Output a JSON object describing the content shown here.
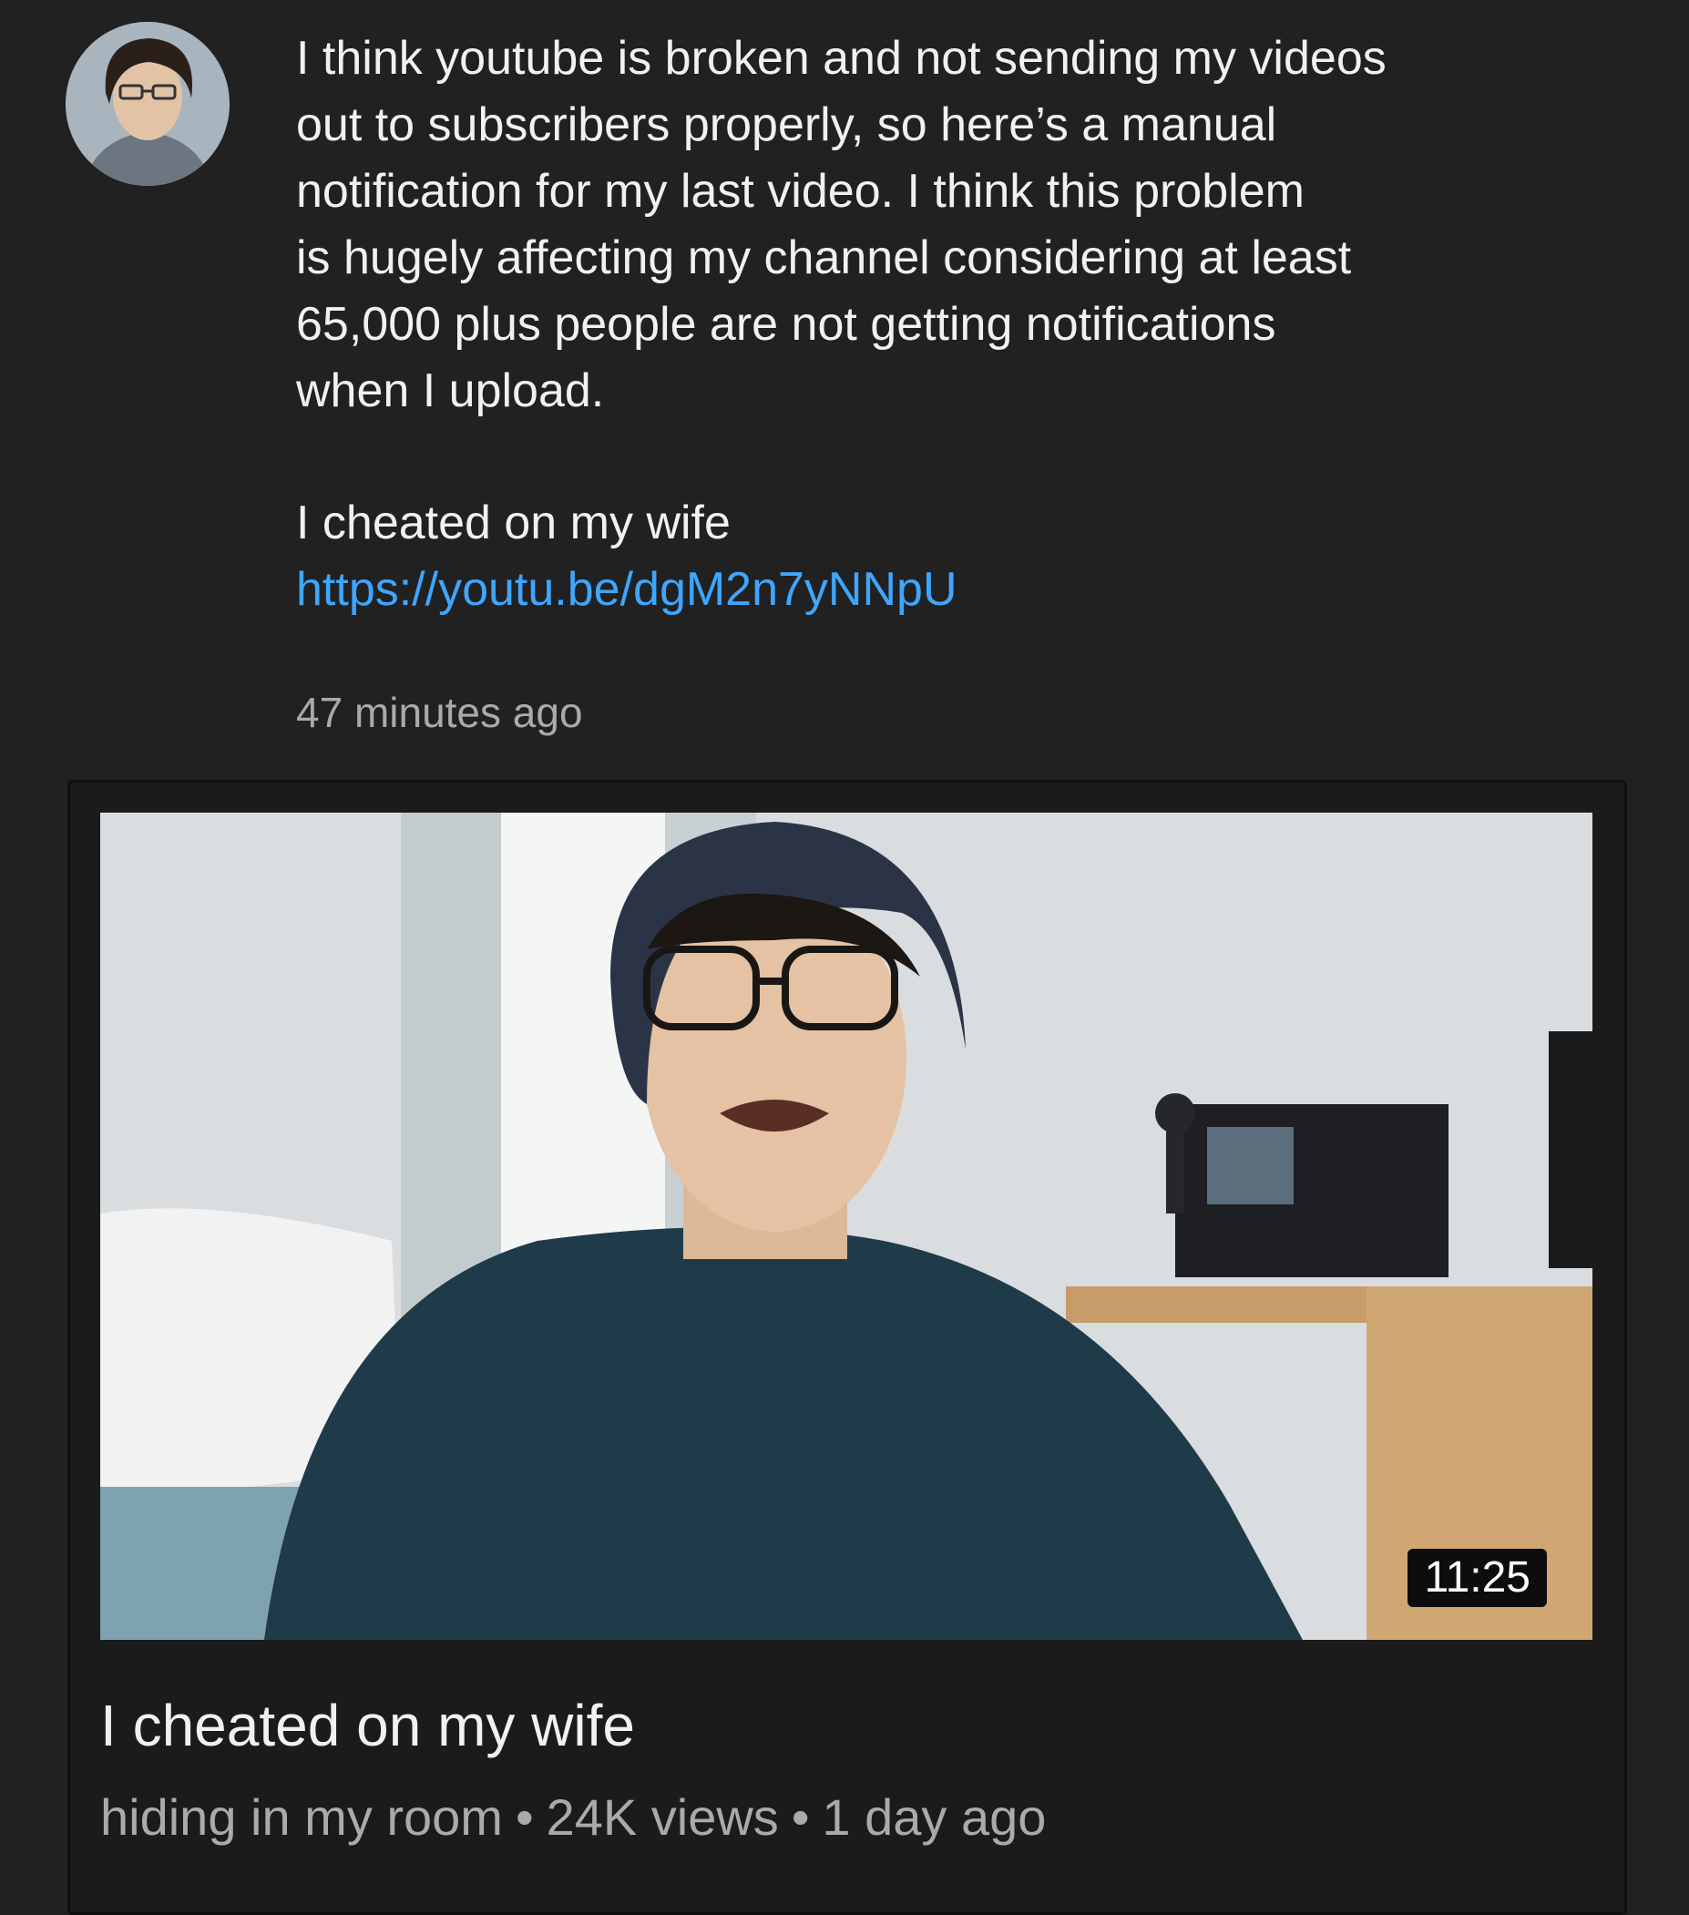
{
  "post": {
    "text_lines": [
      "I think youtube is broken and not sending my videos",
      "out to subscribers properly, so here’s a manual",
      "notification for my last video. I think this problem",
      "is hugely affecting my channel considering at least",
      "65,000 plus people are not getting notifications",
      "when I upload."
    ],
    "video_title": "I cheated on my wife",
    "link": "https://youtu.be/dgM2n7yNNpU",
    "time_ago": "47 minutes ago"
  },
  "video_card": {
    "duration": "11:25",
    "title": "I cheated on my wife",
    "channel": "hiding in my room",
    "separator": "•",
    "views": "24K views",
    "uploaded": "1 day ago"
  },
  "colors": {
    "background": "#212121",
    "link": "#3ea6ff",
    "secondary_text": "#aaaaaa"
  }
}
